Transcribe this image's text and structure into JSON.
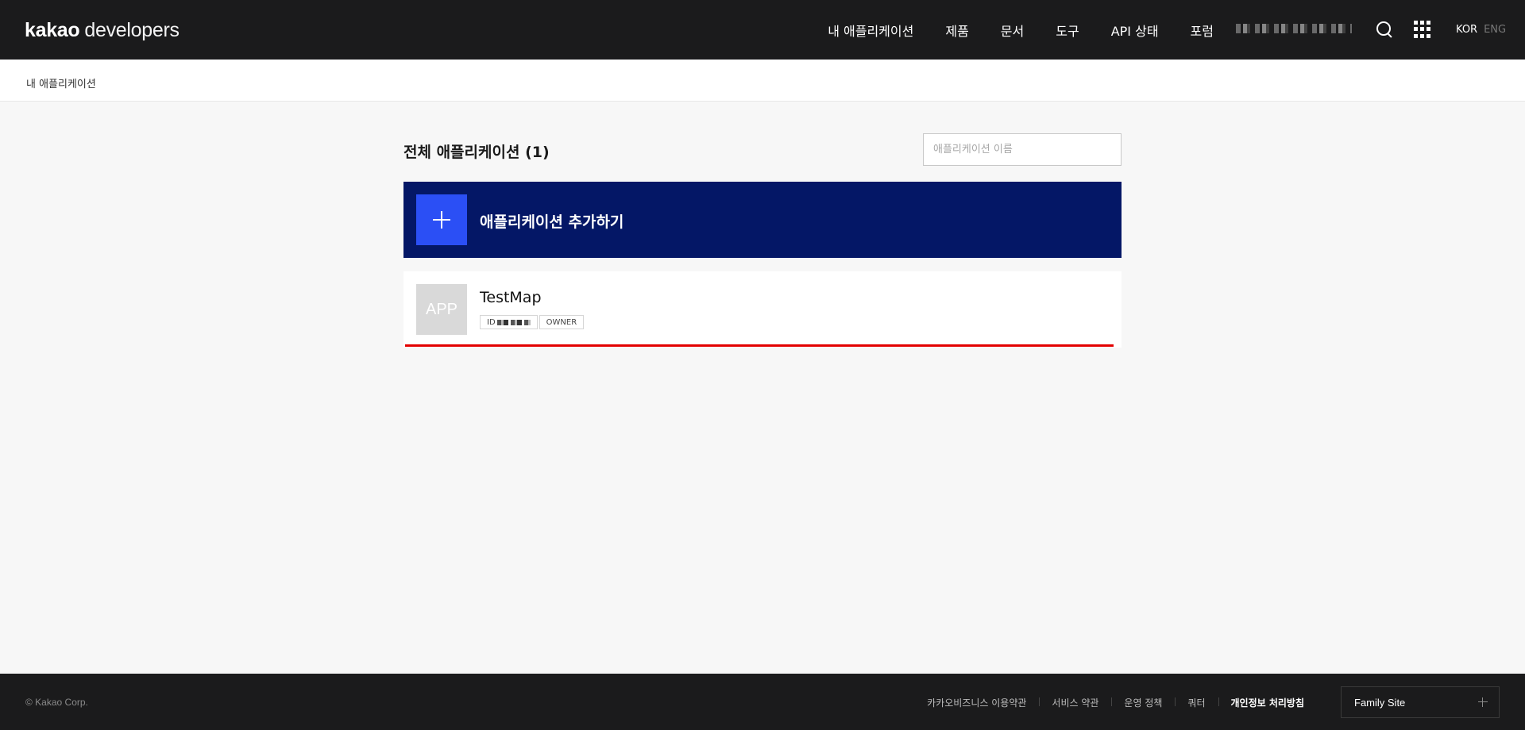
{
  "header": {
    "logo_bold": "kakao",
    "logo_light": "developers",
    "nav": [
      "내 애플리케이션",
      "제품",
      "문서",
      "도구",
      "API 상태",
      "포럼"
    ],
    "lang_active": "KOR",
    "lang_inactive": "ENG"
  },
  "breadcrumb": "내 애플리케이션",
  "main": {
    "title": "전체 애플리케이션 (1)",
    "search_placeholder": "애플리케이션 이름",
    "add_label": "애플리케이션 추가하기",
    "apps": [
      {
        "thumb": "APP",
        "name": "TestMap",
        "id_label": "ID",
        "role": "OWNER"
      }
    ]
  },
  "footer": {
    "copyright": "© Kakao Corp.",
    "links": [
      "카카오비즈니스 이용약관",
      "서비스 약관",
      "운영 정책",
      "쿼터",
      "개인정보 처리방침"
    ],
    "family_site": "Family Site"
  },
  "colors": {
    "header_bg": "#1b1b1c",
    "add_card_bg": "#041766",
    "add_icon_bg": "#2b4ff5",
    "highlight_line": "#e30000"
  }
}
